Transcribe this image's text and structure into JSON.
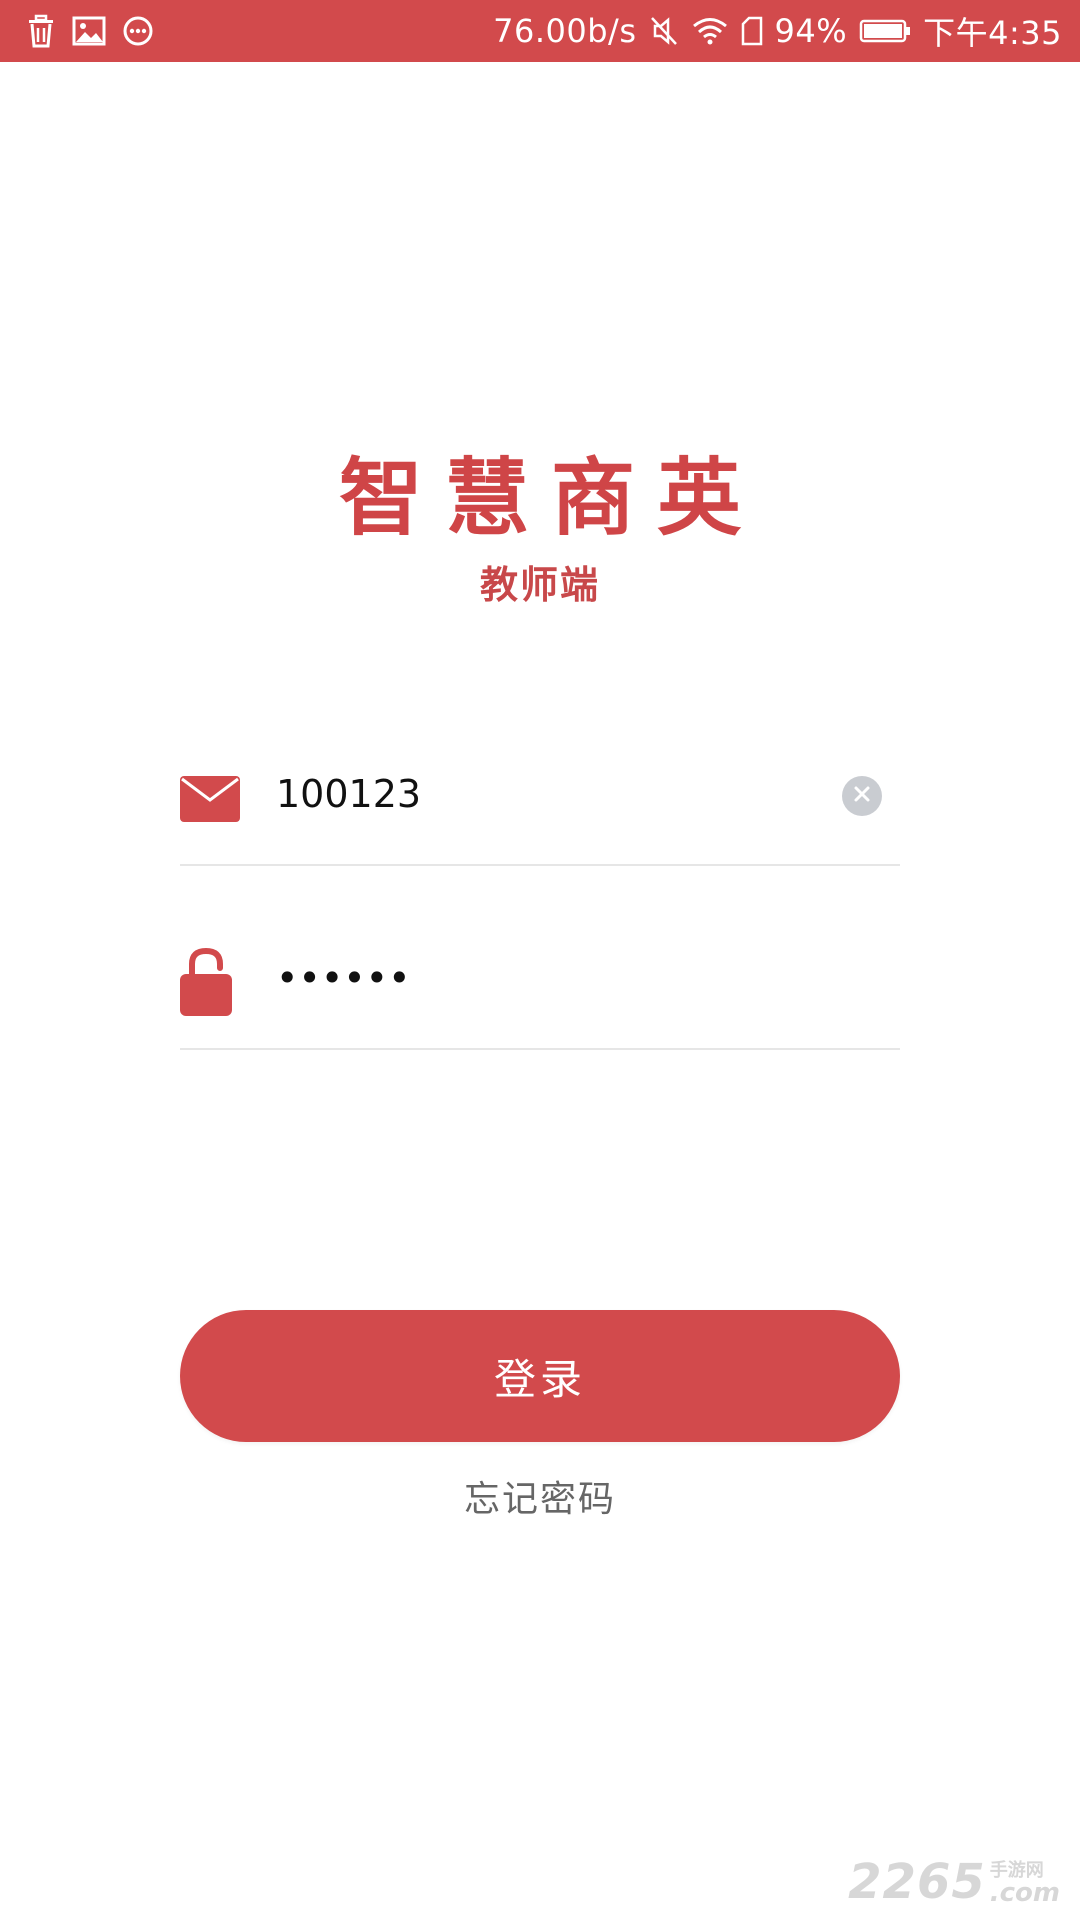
{
  "status_bar": {
    "net_speed": "76.00b/s",
    "battery": "94%",
    "time": "下午4:35",
    "left_icons": [
      "trash-icon",
      "image-icon",
      "more-circle-icon"
    ],
    "right_icons": [
      "mute-icon",
      "wifi-icon",
      "sim-icon",
      "battery-icon"
    ]
  },
  "app": {
    "title": "智慧商英",
    "subtitle": "教师端"
  },
  "form": {
    "username": {
      "value": "100123",
      "icon": "envelope-icon"
    },
    "password": {
      "value": "••••••",
      "icon": "lock-icon"
    },
    "login_label": "登录",
    "forgot_label": "忘记密码"
  },
  "watermark": {
    "main": "2265",
    "dotcom": ".com",
    "small": "手游网"
  },
  "colors": {
    "brand": "#d24a4c",
    "divider": "#e6e6e6",
    "clear_button": "#c9ccd1"
  }
}
